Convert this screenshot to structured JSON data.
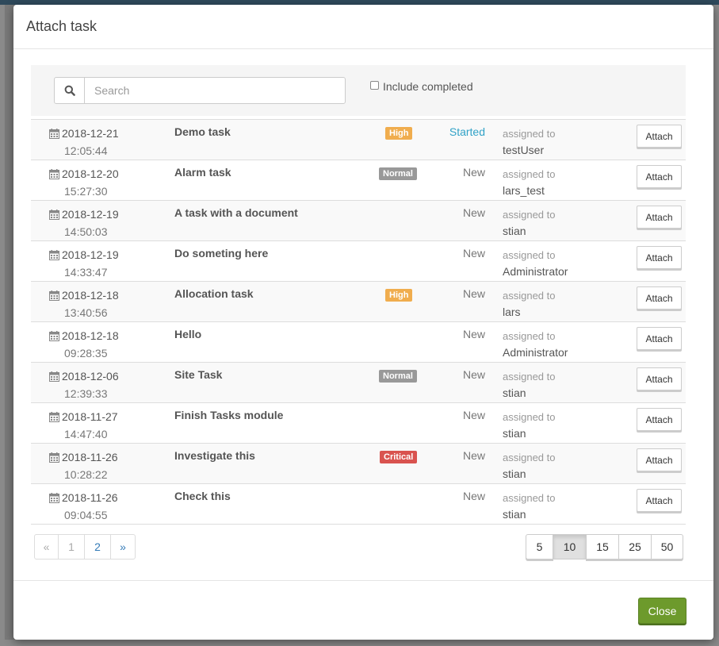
{
  "modal": {
    "title": "Attach task",
    "close_label": "Close"
  },
  "filter": {
    "search_placeholder": "Search",
    "search_value": "",
    "search_icon": "search-icon",
    "include_completed_label": "Include completed",
    "include_completed_checked": false
  },
  "tasks": [
    {
      "date": "2018-12-21",
      "time": "12:05:44",
      "title": "Demo task",
      "priority": "High",
      "priority_color": "#f0ad4e",
      "status": "Started",
      "assigned_label": "assigned to",
      "assignee": "testUser",
      "action": "Attach"
    },
    {
      "date": "2018-12-20",
      "time": "15:27:30",
      "title": "Alarm task",
      "priority": "Normal",
      "priority_color": "#999999",
      "status": "New",
      "assigned_label": "assigned to",
      "assignee": "lars_test",
      "action": "Attach"
    },
    {
      "date": "2018-12-19",
      "time": "14:50:03",
      "title": "A task with a document",
      "priority": "",
      "status": "New",
      "assigned_label": "assigned to",
      "assignee": "stian",
      "action": "Attach"
    },
    {
      "date": "2018-12-19",
      "time": "14:33:47",
      "title": "Do someting here",
      "priority": "",
      "status": "New",
      "assigned_label": "assigned to",
      "assignee": "Administrator",
      "action": "Attach"
    },
    {
      "date": "2018-12-18",
      "time": "13:40:56",
      "title": "Allocation task",
      "priority": "High",
      "priority_color": "#f0ad4e",
      "status": "New",
      "assigned_label": "assigned to",
      "assignee": "lars",
      "action": "Attach"
    },
    {
      "date": "2018-12-18",
      "time": "09:28:35",
      "title": "Hello",
      "priority": "",
      "status": "New",
      "assigned_label": "assigned to",
      "assignee": "Administrator",
      "action": "Attach"
    },
    {
      "date": "2018-12-06",
      "time": "12:39:33",
      "title": "Site Task",
      "priority": "Normal",
      "priority_color": "#999999",
      "status": "New",
      "assigned_label": "assigned to",
      "assignee": "stian",
      "action": "Attach"
    },
    {
      "date": "2018-11-27",
      "time": "14:47:40",
      "title": "Finish Tasks module",
      "priority": "",
      "status": "New",
      "assigned_label": "assigned to",
      "assignee": "stian",
      "action": "Attach"
    },
    {
      "date": "2018-11-26",
      "time": "10:28:22",
      "title": "Investigate this",
      "priority": "Critical",
      "priority_color": "#d9534f",
      "status": "New",
      "assigned_label": "assigned to",
      "assignee": "stian",
      "action": "Attach"
    },
    {
      "date": "2018-11-26",
      "time": "09:04:55",
      "title": "Check this",
      "priority": "",
      "status": "New",
      "assigned_label": "assigned to",
      "assignee": "stian",
      "action": "Attach"
    }
  ],
  "pagination": {
    "prev": "«",
    "pages": [
      "1",
      "2"
    ],
    "next": "»",
    "current_page": "1"
  },
  "page_size": {
    "options": [
      "5",
      "10",
      "15",
      "25",
      "50"
    ],
    "selected": "10"
  },
  "colors": {
    "started_status": "#31a2c7",
    "close_button": "#6d9a2c",
    "link": "#337ab7"
  },
  "icons": {
    "calendar": "calendar-icon"
  }
}
